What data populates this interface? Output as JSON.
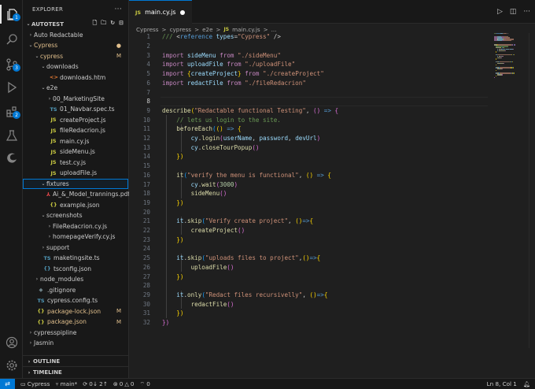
{
  "sidebar": {
    "title": "EXPLORER",
    "more": "···",
    "root": "AUTOTEST",
    "tree": [
      {
        "indent": 0,
        "chev": "›",
        "icon": "",
        "label": "Auto Redactable",
        "mark": "",
        "color": "#cccccc"
      },
      {
        "indent": 0,
        "chev": "⌄",
        "icon": "",
        "label": "Cypress",
        "mark": "●",
        "color": "#e2c08d"
      },
      {
        "indent": 1,
        "chev": "⌄",
        "icon": "",
        "label": "cypress",
        "mark": "M",
        "color": "#e2c08d"
      },
      {
        "indent": 2,
        "chev": "⌄",
        "icon": "",
        "label": "downloads",
        "mark": "",
        "color": "#cccccc"
      },
      {
        "indent": 3,
        "chev": "",
        "icon": "<>",
        "iconColor": "#e37933",
        "label": "downloads.htm",
        "mark": "",
        "color": "#cccccc"
      },
      {
        "indent": 2,
        "chev": "⌄",
        "icon": "",
        "label": "e2e",
        "mark": "",
        "color": "#cccccc"
      },
      {
        "indent": 3,
        "chev": "›",
        "icon": "",
        "label": "00_MarketingSite",
        "mark": "",
        "color": "#cccccc"
      },
      {
        "indent": 3,
        "chev": "",
        "icon": "TS",
        "iconColor": "#519aba",
        "label": "01_Navbar.spec.ts",
        "mark": "",
        "color": "#cccccc"
      },
      {
        "indent": 3,
        "chev": "",
        "icon": "JS",
        "iconColor": "#cbcb41",
        "label": "createProject.js",
        "mark": "",
        "color": "#cccccc"
      },
      {
        "indent": 3,
        "chev": "",
        "icon": "JS",
        "iconColor": "#cbcb41",
        "label": "fileRedacrion.js",
        "mark": "",
        "color": "#cccccc"
      },
      {
        "indent": 3,
        "chev": "",
        "icon": "JS",
        "iconColor": "#cbcb41",
        "label": "main.cy.js",
        "mark": "",
        "color": "#cccccc"
      },
      {
        "indent": 3,
        "chev": "",
        "icon": "JS",
        "iconColor": "#cbcb41",
        "label": "sideMenu.js",
        "mark": "",
        "color": "#cccccc"
      },
      {
        "indent": 3,
        "chev": "",
        "icon": "JS",
        "iconColor": "#cbcb41",
        "label": "test.cy.js",
        "mark": "",
        "color": "#cccccc"
      },
      {
        "indent": 3,
        "chev": "",
        "icon": "JS",
        "iconColor": "#cbcb41",
        "label": "uploadFile.js",
        "mark": "",
        "color": "#cccccc"
      },
      {
        "indent": 2,
        "chev": "⌄",
        "icon": "",
        "label": "fixtures",
        "mark": "",
        "color": "#cccccc",
        "selected": true
      },
      {
        "indent": 3,
        "chev": "",
        "icon": "⅄",
        "iconColor": "#e8484b",
        "label": "Ai_&_Model_trannings.pdf",
        "mark": "",
        "color": "#cccccc"
      },
      {
        "indent": 3,
        "chev": "",
        "icon": "{}",
        "iconColor": "#cbcb41",
        "label": "example.json",
        "mark": "",
        "color": "#cccccc"
      },
      {
        "indent": 2,
        "chev": "⌄",
        "icon": "",
        "label": "screenshots",
        "mark": "",
        "color": "#cccccc"
      },
      {
        "indent": 3,
        "chev": "›",
        "icon": "",
        "label": "FileRedacrion.cy.js",
        "mark": "",
        "color": "#cccccc"
      },
      {
        "indent": 3,
        "chev": "›",
        "icon": "",
        "label": "homepageVerify.cy.js",
        "mark": "",
        "color": "#cccccc"
      },
      {
        "indent": 2,
        "chev": "›",
        "icon": "",
        "label": "support",
        "mark": "",
        "color": "#cccccc"
      },
      {
        "indent": 2,
        "chev": "",
        "icon": "TS",
        "iconColor": "#519aba",
        "label": "maketingsite.ts",
        "mark": "",
        "color": "#cccccc"
      },
      {
        "indent": 2,
        "chev": "",
        "icon": "{}",
        "iconColor": "#519aba",
        "label": "tsconfig.json",
        "mark": "",
        "color": "#cccccc"
      },
      {
        "indent": 1,
        "chev": "›",
        "icon": "",
        "label": "node_modules",
        "mark": "",
        "color": "#cccccc"
      },
      {
        "indent": 1,
        "chev": "",
        "icon": "◆",
        "iconColor": "#6d8086",
        "label": ".gitignore",
        "mark": "",
        "color": "#cccccc"
      },
      {
        "indent": 1,
        "chev": "",
        "icon": "TS",
        "iconColor": "#519aba",
        "label": "cypress.config.ts",
        "mark": "",
        "color": "#cccccc"
      },
      {
        "indent": 1,
        "chev": "",
        "icon": "{}",
        "iconColor": "#cbcb41",
        "label": "package-lock.json",
        "mark": "M",
        "color": "#e2c08d"
      },
      {
        "indent": 1,
        "chev": "",
        "icon": "{}",
        "iconColor": "#cbcb41",
        "label": "package.json",
        "mark": "M",
        "color": "#e2c08d"
      },
      {
        "indent": 0,
        "chev": "›",
        "icon": "",
        "label": "cypresspipline",
        "mark": "",
        "color": "#cccccc"
      },
      {
        "indent": 0,
        "chev": "›",
        "icon": "",
        "label": "Jasmin",
        "mark": "",
        "color": "#cccccc"
      }
    ],
    "outline": "OUTLINE",
    "timeline": "TIMELINE"
  },
  "editor": {
    "tab": {
      "icon": "JS",
      "label": "main.cy.js"
    },
    "breadcrumb": [
      "Cypress",
      ">",
      "cypress",
      ">",
      "e2e",
      ">",
      "JS",
      "main.cy.js",
      ">",
      "..."
    ],
    "current_line": 8,
    "lines": [
      [
        [
          "tk-com",
          "/// "
        ],
        [
          "tk-punc",
          "<"
        ],
        [
          "tk-tag",
          "reference"
        ],
        [
          "tk-var",
          " types"
        ],
        [
          "tk-punc",
          "="
        ],
        [
          "tk-str",
          "\"Cypress\""
        ],
        [
          "tk-punc",
          " />"
        ]
      ],
      [],
      [
        [
          "tk-kw",
          "import "
        ],
        [
          "tk-var",
          "sideMenu "
        ],
        [
          "tk-kw",
          "from "
        ],
        [
          "tk-str",
          "\"./sideMenu\""
        ]
      ],
      [
        [
          "tk-kw",
          "import "
        ],
        [
          "tk-var",
          "uploadFile "
        ],
        [
          "tk-kw",
          "from "
        ],
        [
          "tk-str",
          "\"./uploadFile\""
        ]
      ],
      [
        [
          "tk-kw",
          "import "
        ],
        [
          "tk-b1",
          "{"
        ],
        [
          "tk-var",
          "createProject"
        ],
        [
          "tk-b1",
          "}"
        ],
        [
          "tk-kw",
          " from "
        ],
        [
          "tk-str",
          "\"./createProject\""
        ]
      ],
      [
        [
          "tk-kw",
          "import "
        ],
        [
          "tk-var",
          "redactFile "
        ],
        [
          "tk-kw",
          "from "
        ],
        [
          "tk-str",
          "\"./fileRedacrion\""
        ]
      ],
      [],
      [],
      [
        [
          "tk-fn",
          "describe"
        ],
        [
          "tk-b1",
          "("
        ],
        [
          "tk-str",
          "\"Redactable functional Testing\""
        ],
        [
          "tk-punc",
          ", "
        ],
        [
          "tk-b2",
          "()"
        ],
        [
          "tk-fnk",
          " => "
        ],
        [
          "tk-b2",
          "{"
        ]
      ],
      [
        [
          "tk-com",
          "    // lets us login to the site."
        ]
      ],
      [
        [
          "tk-fn",
          "    beforeEach"
        ],
        [
          "tk-b3",
          "("
        ],
        [
          "tk-b1",
          "()"
        ],
        [
          "tk-fnk",
          " => "
        ],
        [
          "tk-b1",
          "{"
        ]
      ],
      [
        [
          "tk-var",
          "        cy"
        ],
        [
          "tk-punc",
          "."
        ],
        [
          "tk-fn",
          "login"
        ],
        [
          "tk-b2",
          "("
        ],
        [
          "tk-var",
          "userName"
        ],
        [
          "tk-punc",
          ", "
        ],
        [
          "tk-var",
          "password"
        ],
        [
          "tk-punc",
          ", "
        ],
        [
          "tk-var",
          "devUrl"
        ],
        [
          "tk-b2",
          ")"
        ]
      ],
      [
        [
          "tk-var",
          "        cy"
        ],
        [
          "tk-punc",
          "."
        ],
        [
          "tk-fn",
          "closeTourPopup"
        ],
        [
          "tk-b2",
          "()"
        ]
      ],
      [
        [
          "tk-b1",
          "    })"
        ]
      ],
      [],
      [
        [
          "tk-fn",
          "    it"
        ],
        [
          "tk-b3",
          "("
        ],
        [
          "tk-str",
          "\"verify the menu is functional\""
        ],
        [
          "tk-punc",
          ", "
        ],
        [
          "tk-b1",
          "()"
        ],
        [
          "tk-fnk",
          " => "
        ],
        [
          "tk-b1",
          "{"
        ]
      ],
      [
        [
          "tk-var",
          "        cy"
        ],
        [
          "tk-punc",
          "."
        ],
        [
          "tk-fn",
          "wait"
        ],
        [
          "tk-b2",
          "("
        ],
        [
          "tk-num",
          "3000"
        ],
        [
          "tk-b2",
          ")"
        ]
      ],
      [
        [
          "tk-fn",
          "        sideMenu"
        ],
        [
          "tk-b2",
          "()"
        ]
      ],
      [
        [
          "tk-b1",
          "    })"
        ]
      ],
      [],
      [
        [
          "tk-var",
          "    it"
        ],
        [
          "tk-punc",
          "."
        ],
        [
          "tk-fn",
          "skip"
        ],
        [
          "tk-b3",
          "("
        ],
        [
          "tk-str",
          "\"Verify create project\""
        ],
        [
          "tk-punc",
          ", "
        ],
        [
          "tk-b1",
          "()"
        ],
        [
          "tk-fnk",
          "=>"
        ],
        [
          "tk-b1",
          "{"
        ]
      ],
      [
        [
          "tk-fn",
          "        createProject"
        ],
        [
          "tk-b2",
          "()"
        ]
      ],
      [
        [
          "tk-b1",
          "    })"
        ]
      ],
      [],
      [
        [
          "tk-var",
          "    it"
        ],
        [
          "tk-punc",
          "."
        ],
        [
          "tk-fn",
          "skip"
        ],
        [
          "tk-b3",
          "("
        ],
        [
          "tk-str",
          "\"uploads files to project\""
        ],
        [
          "tk-punc",
          ","
        ],
        [
          "tk-b1",
          "()"
        ],
        [
          "tk-fnk",
          "=>"
        ],
        [
          "tk-b1",
          "{"
        ]
      ],
      [
        [
          "tk-fn",
          "        uploadFile"
        ],
        [
          "tk-b2",
          "()"
        ]
      ],
      [
        [
          "tk-b1",
          "    })"
        ]
      ],
      [],
      [
        [
          "tk-var",
          "    it"
        ],
        [
          "tk-punc",
          "."
        ],
        [
          "tk-fn",
          "only"
        ],
        [
          "tk-b3",
          "("
        ],
        [
          "tk-str",
          "\"Redact files recursivelly\""
        ],
        [
          "tk-punc",
          ", "
        ],
        [
          "tk-b1",
          "()"
        ],
        [
          "tk-fnk",
          "=>"
        ],
        [
          "tk-b1",
          "{"
        ]
      ],
      [
        [
          "tk-fn",
          "        redactFile"
        ],
        [
          "tk-b2",
          "()"
        ]
      ],
      [
        [
          "tk-b1",
          "    })"
        ]
      ],
      [
        [
          "tk-b2",
          "})"
        ]
      ]
    ]
  },
  "statusbar": {
    "remote": "⇄",
    "project": "Cypress",
    "branch": "main*",
    "sync": "0↓ 2↑",
    "problems": "0",
    "warnings": "0",
    "ports": "0",
    "cursor": "Ln 8, Col 1"
  }
}
